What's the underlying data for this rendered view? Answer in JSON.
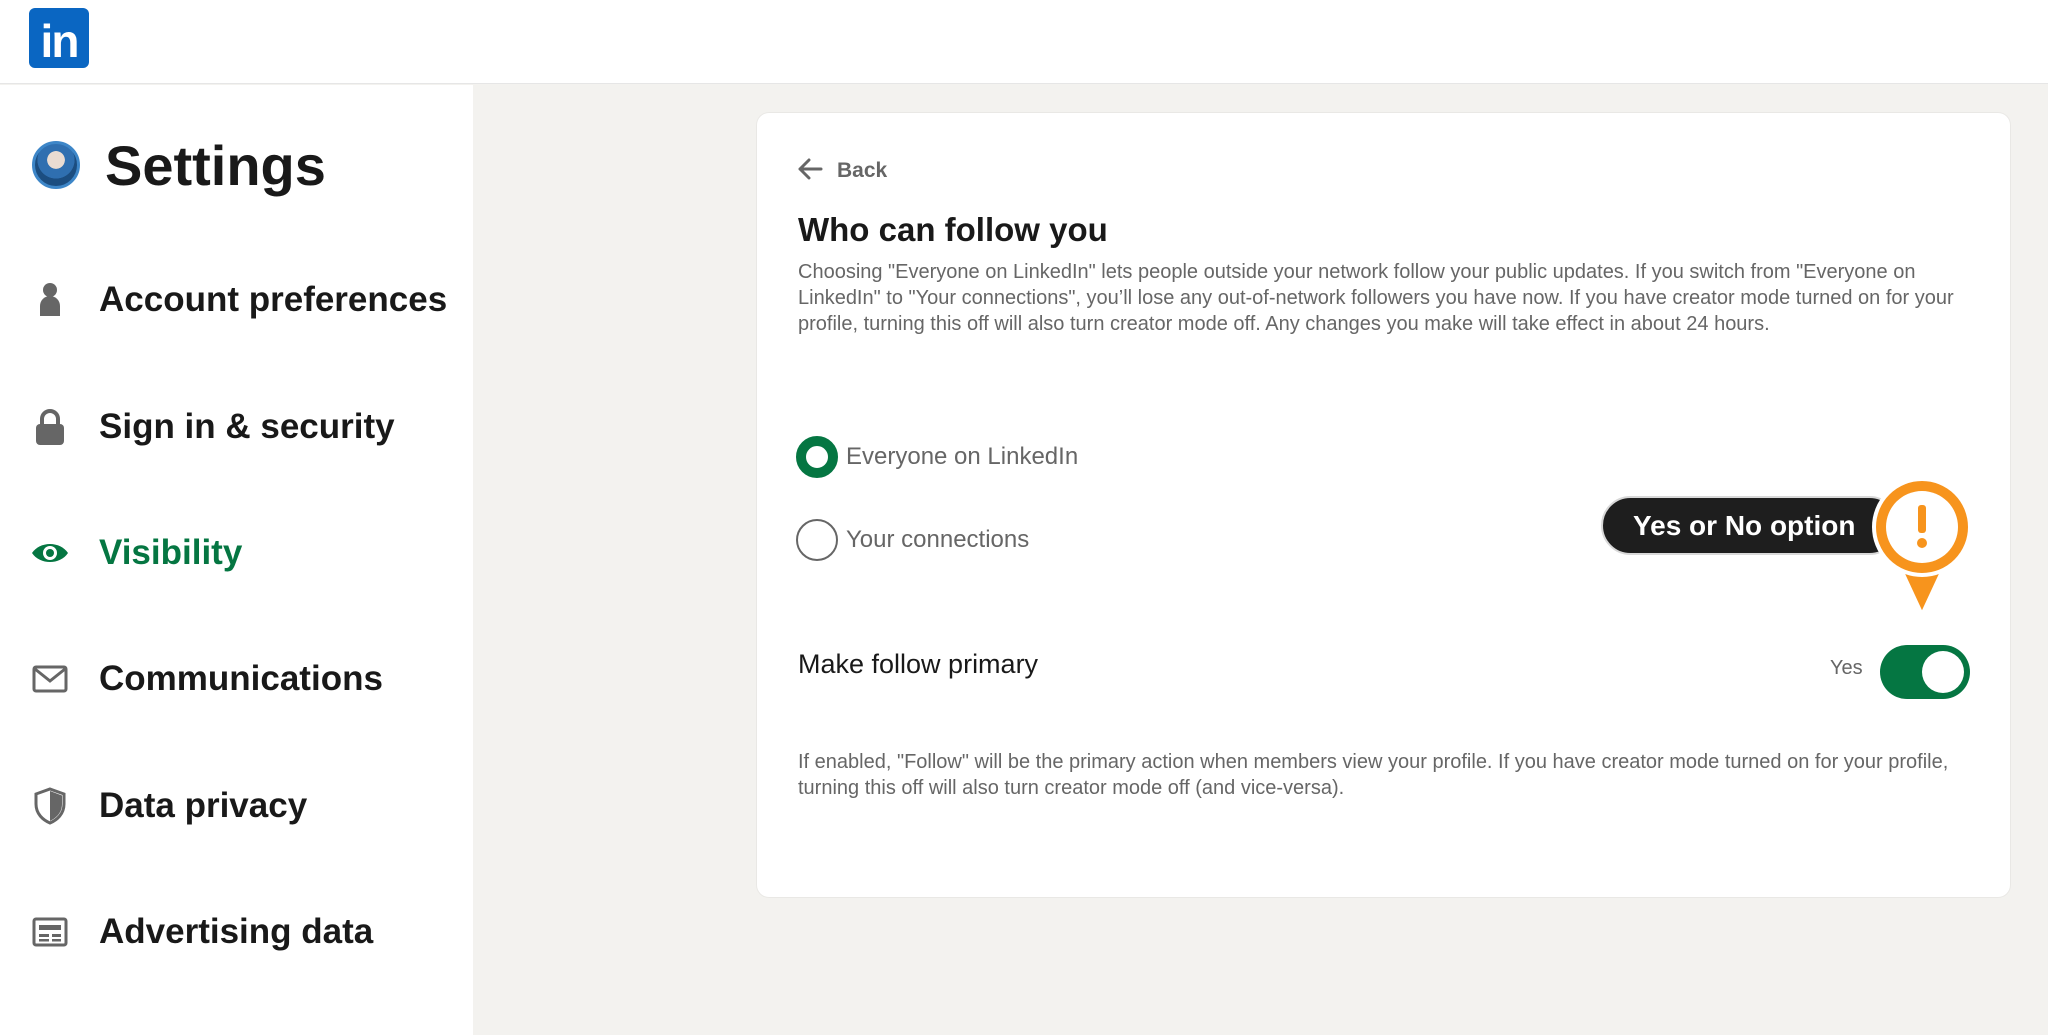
{
  "app": {
    "logo_text": "in",
    "brand_color": "#0a66c2",
    "accent_color": "#057642"
  },
  "sidebar": {
    "title": "Settings",
    "items": [
      {
        "label": "Account preferences",
        "icon": "person-icon",
        "active": false
      },
      {
        "label": "Sign in & security",
        "icon": "lock-icon",
        "active": false
      },
      {
        "label": "Visibility",
        "icon": "eye-icon",
        "active": true
      },
      {
        "label": "Communications",
        "icon": "envelope-icon",
        "active": false
      },
      {
        "label": "Data privacy",
        "icon": "shield-icon",
        "active": false
      },
      {
        "label": "Advertising data",
        "icon": "newspaper-icon",
        "active": false
      }
    ]
  },
  "content": {
    "back_label": "Back",
    "heading": "Who can follow you",
    "description": "Choosing \"Everyone on LinkedIn\" lets people outside your network follow your public updates. If you switch from \"Everyone on LinkedIn\" to \"Your connections\", you’ll lose any out-of-network followers you have now. If you have creator mode turned on for your profile, turning this off will also turn creator mode off. Any changes you make will take effect in about 24 hours.",
    "options": [
      {
        "label": "Everyone on LinkedIn",
        "selected": true
      },
      {
        "label": "Your connections",
        "selected": false
      }
    ],
    "callout": {
      "text": "Yes or No option",
      "icon": "exclamation-pin-icon",
      "color": "#f7941d"
    },
    "follow_primary": {
      "label": "Make follow primary",
      "state_label": "Yes",
      "enabled": true
    },
    "note": "If enabled, \"Follow\" will be the primary action when members view your profile. If you have creator mode turned on for your profile, turning this off will also turn creator mode off (and vice-versa)."
  }
}
